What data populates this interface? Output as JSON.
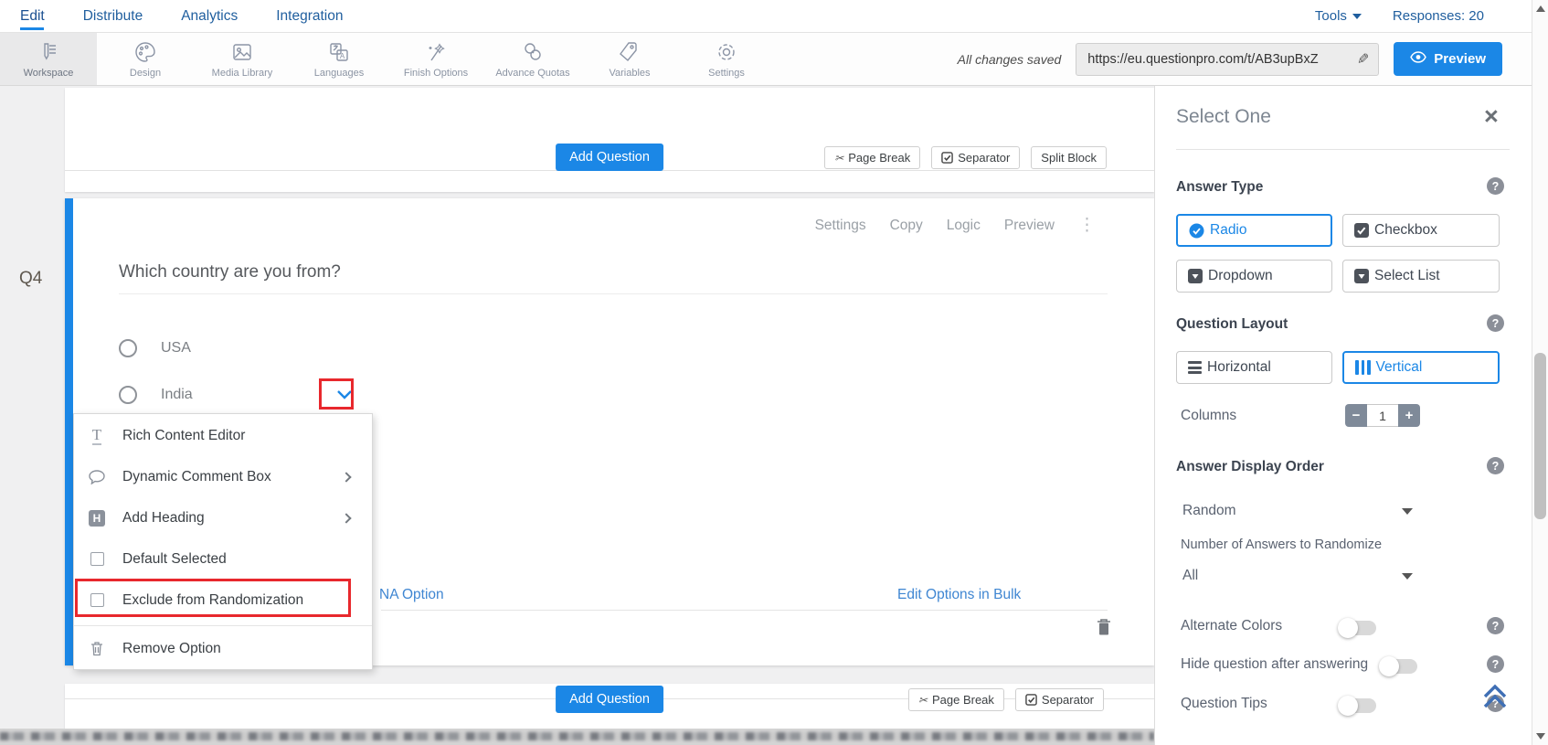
{
  "nav": {
    "tabs": [
      {
        "label": "Edit",
        "active": true
      },
      {
        "label": "Distribute",
        "active": false
      },
      {
        "label": "Analytics",
        "active": false
      },
      {
        "label": "Integration",
        "active": false
      }
    ],
    "tools_label": "Tools",
    "responses_label": "Responses: 20"
  },
  "toolbar": {
    "items": [
      {
        "label": "Workspace",
        "icon": "workspace-icon",
        "active": true
      },
      {
        "label": "Design",
        "icon": "palette-icon",
        "active": false
      },
      {
        "label": "Media Library",
        "icon": "image-icon",
        "active": false
      },
      {
        "label": "Languages",
        "icon": "translate-icon",
        "active": false
      },
      {
        "label": "Finish Options",
        "icon": "wand-icon",
        "active": false
      },
      {
        "label": "Advance Quotas",
        "icon": "chain-link-icon",
        "active": false
      },
      {
        "label": "Variables",
        "icon": "tag-icon",
        "active": false
      },
      {
        "label": "Settings",
        "icon": "gear-icon",
        "active": false
      }
    ],
    "status_text": "All changes saved",
    "url_value": "https://eu.questionpro.com/t/AB3upBxZ",
    "preview_label": "Preview"
  },
  "canvas": {
    "question_number": "Q4",
    "add_question_label": "Add Question",
    "top_actions": [
      "Page Break",
      "Separator",
      "Split Block"
    ],
    "bottom_actions": [
      "Page Break",
      "Separator"
    ],
    "question": {
      "actions": [
        "Settings",
        "Copy",
        "Logic",
        "Preview"
      ],
      "title": "Which country are you from?",
      "options": [
        "USA",
        "India"
      ],
      "na_option_label": "NA Option",
      "edit_bulk_label": "Edit Options in Bulk"
    },
    "option_menu": {
      "items": [
        {
          "label": "Rich Content Editor",
          "icon": "text-tool-icon",
          "submenu": false,
          "highlighted": false
        },
        {
          "label": "Dynamic Comment Box",
          "icon": "comment-icon",
          "submenu": true,
          "highlighted": false
        },
        {
          "label": "Add Heading",
          "icon": "heading-icon",
          "submenu": true,
          "highlighted": false
        },
        {
          "label": "Default Selected",
          "icon": "checkbox",
          "submenu": false,
          "highlighted": false
        },
        {
          "label": "Exclude from Randomization",
          "icon": "checkbox",
          "submenu": false,
          "highlighted": true
        },
        {
          "label": "Remove Option",
          "icon": "trash-icon",
          "submenu": false,
          "highlighted": false
        }
      ]
    }
  },
  "sidebar": {
    "title": "Select One",
    "answer_type": {
      "label": "Answer Type",
      "options": [
        {
          "label": "Radio",
          "selected": true
        },
        {
          "label": "Checkbox",
          "selected": false
        },
        {
          "label": "Dropdown",
          "selected": false
        },
        {
          "label": "Select List",
          "selected": false
        }
      ]
    },
    "question_layout": {
      "label": "Question Layout",
      "options": [
        {
          "label": "Horizontal",
          "selected": false
        },
        {
          "label": "Vertical",
          "selected": true
        }
      ],
      "columns_label": "Columns",
      "columns_value": "1"
    },
    "answer_display_order": {
      "label": "Answer Display Order",
      "value": "Random",
      "randomize_label": "Number of Answers to Randomize",
      "randomize_value": "All"
    },
    "toggles": [
      {
        "label": "Alternate Colors",
        "on": false
      },
      {
        "label": "Hide question after answering",
        "on": false
      },
      {
        "label": "Question Tips",
        "on": false
      }
    ]
  },
  "colors": {
    "accent_blue": "#1b87e6",
    "nav_blue": "#1f5e9e",
    "link_blue": "#3f86d2",
    "annotation_red": "#e8282d"
  }
}
